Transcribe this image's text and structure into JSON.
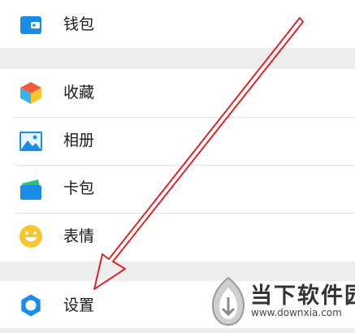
{
  "menu": {
    "items": [
      {
        "label": "钱包",
        "icon": "wallet-icon"
      },
      {
        "label": "收藏",
        "icon": "favorites-cube-icon"
      },
      {
        "label": "相册",
        "icon": "album-picture-icon"
      },
      {
        "label": "卡包",
        "icon": "card-package-icon"
      },
      {
        "label": "表情",
        "icon": "smiley-emoji-icon"
      },
      {
        "label": "设置",
        "icon": "settings-gear-icon"
      }
    ]
  },
  "watermark": {
    "name": "当下软件园",
    "url": "www.downxia.com"
  },
  "colors": {
    "accent_blue": "#1a8de8",
    "arrow_red": "#d8262b",
    "separator_gray": "#ededed"
  }
}
